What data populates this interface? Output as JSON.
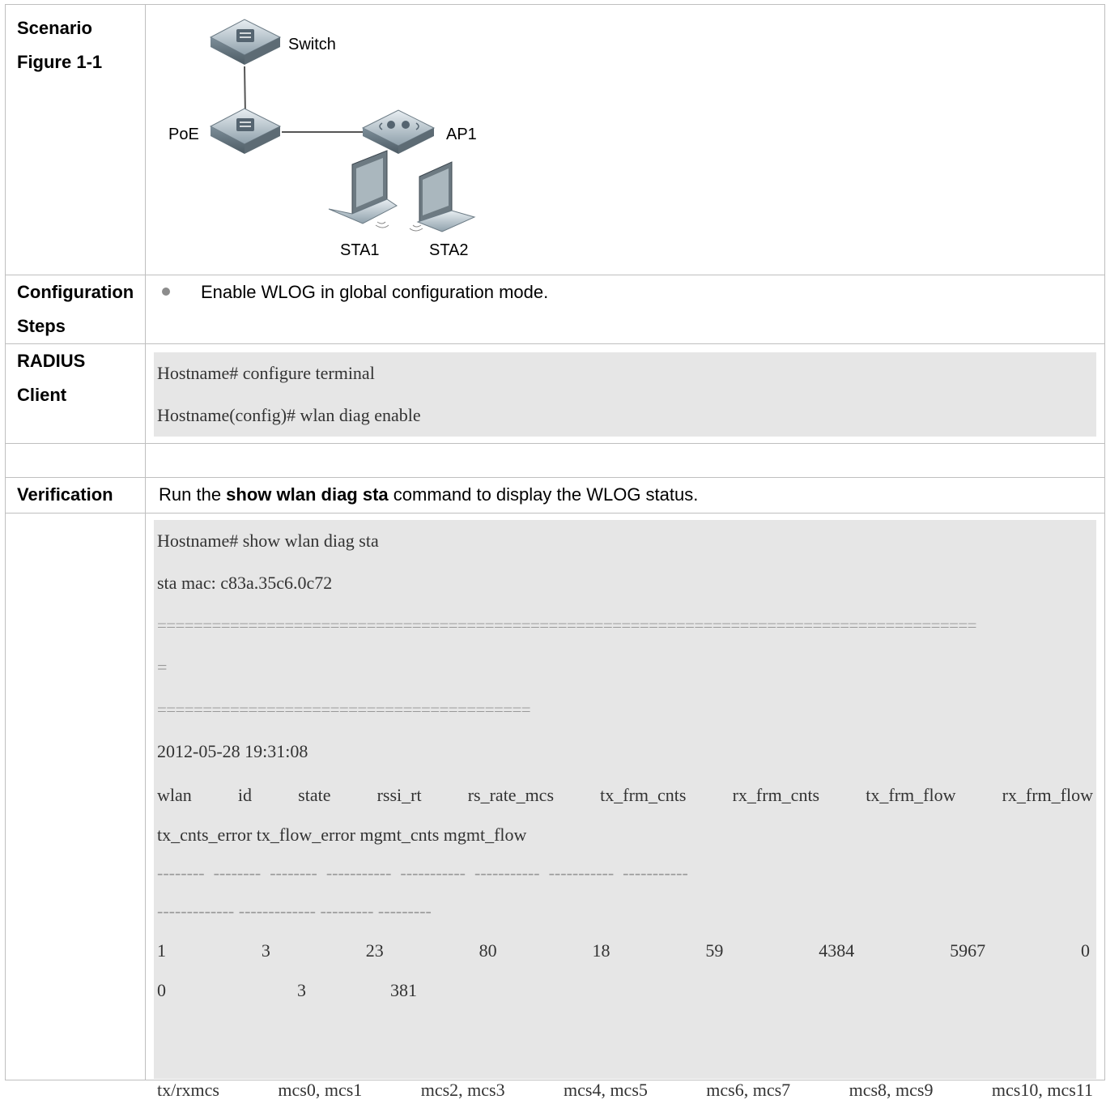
{
  "rows": {
    "scenario": {
      "label1": "Scenario",
      "label2": "Figure 1-1"
    },
    "config": {
      "label1": "Configuration",
      "label2": "Steps",
      "bullet": "Enable WLOG in global configuration mode."
    },
    "radius": {
      "label1": "RADIUS",
      "label2": "Client",
      "code": [
        "Hostname# configure terminal",
        "Hostname(config)# wlan diag enable"
      ]
    },
    "verification": {
      "label": "Verification",
      "pre": "Run the ",
      "cmd": "show wlan diag sta",
      "post": " command to display the WLOG status."
    }
  },
  "diagram": {
    "switch": "Switch",
    "poe": "PoE",
    "ap1": "AP1",
    "sta1": "STA1",
    "sta2": "STA2"
  },
  "output": {
    "l1": "Hostname# show wlan diag sta",
    "l2": "sta mac: c83a.35c6.0c72",
    "sep1": "==========================================================================================",
    "sep1b": "=",
    "sep2": "=========================================",
    "l3": "2012-05-28 19:31:08",
    "h1": [
      "wlan",
      "id",
      "state",
      "rssi_rt",
      "rs_rate_mcs",
      "tx_frm_cnts",
      "rx_frm_cnts",
      "tx_frm_flow",
      "rx_frm_flow"
    ],
    "h2": "tx_cnts_error tx_flow_error mgmt_cnts mgmt_flow",
    "d1": "--------  --------  --------  -----------  -----------  -----------  -----------  -----------",
    "d2": "------------- ------------- --------- ---------",
    "v1": [
      "1",
      "3",
      "23",
      "80",
      "18",
      "59",
      "4384",
      "5967",
      "0"
    ],
    "v2": [
      "0",
      "3",
      "381"
    ],
    "mcs": [
      "tx/rxmcs",
      "mcs0, mcs1",
      "mcs2, mcs3",
      "mcs4, mcs5",
      "mcs6, mcs7",
      "mcs8, mcs9",
      "mcs10, mcs11"
    ]
  }
}
